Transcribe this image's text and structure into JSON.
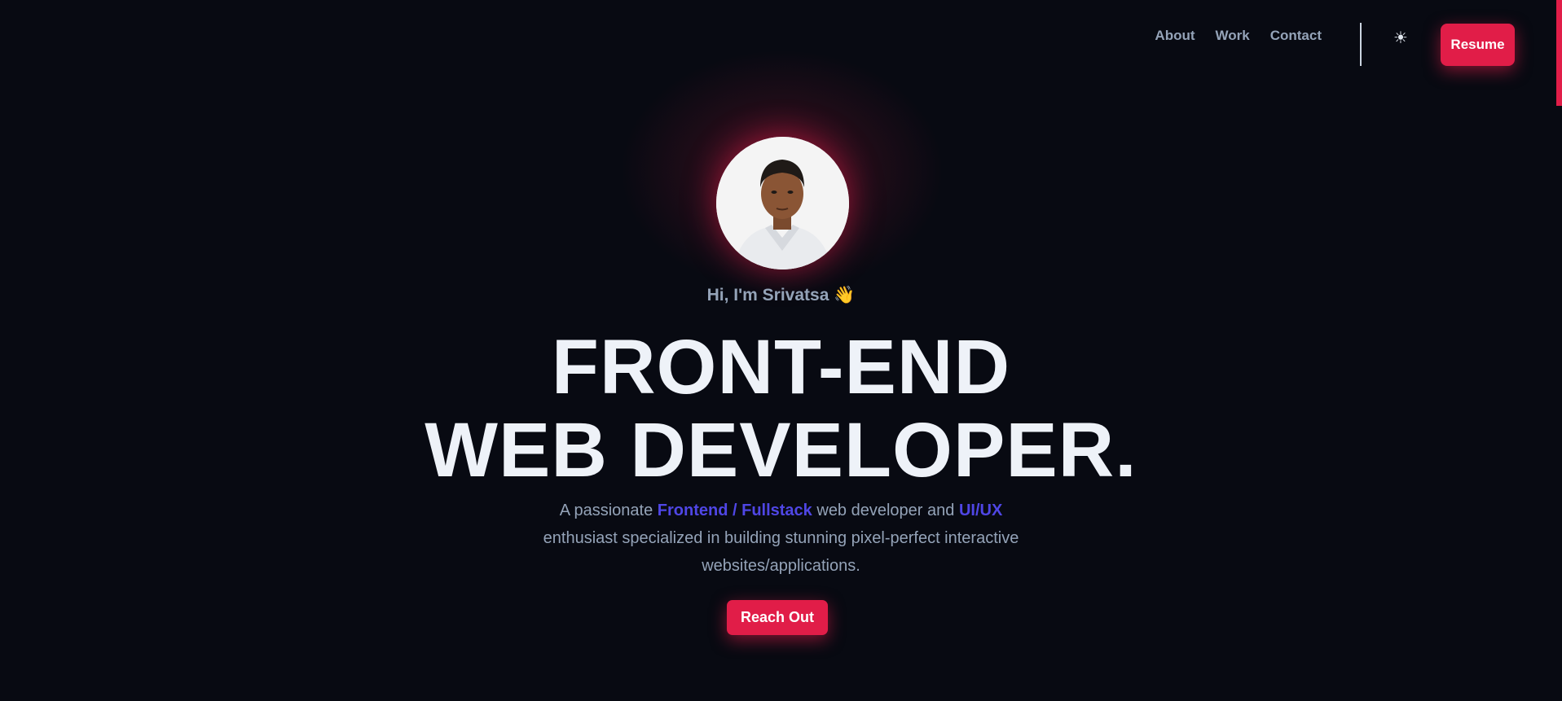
{
  "nav": {
    "links": [
      {
        "label": "About"
      },
      {
        "label": "Work"
      },
      {
        "label": "Contact"
      }
    ],
    "theme_icon": "sun-icon",
    "theme_glyph": "☀",
    "resume_label": "Resume"
  },
  "hero": {
    "avatar_alt": "profile-photo",
    "greeting": "Hi, I'm Srivatsa 👋",
    "headline_line1": "FRONT-END",
    "headline_line2": "WEB DEVELOPER.",
    "description": {
      "part1": "A passionate ",
      "highlight1": "Frontend / Fullstack",
      "part2": " web developer and ",
      "highlight2": "UI/UX",
      "part3": " enthusiast specialized in building stunning pixel-perfect interactive websites/applications."
    },
    "cta_label": "Reach Out"
  },
  "colors": {
    "background": "#080a12",
    "accent": "#e11d48",
    "highlight": "#4f46e5",
    "muted_text": "#94a3b8",
    "headline_text": "#eef2f8"
  }
}
